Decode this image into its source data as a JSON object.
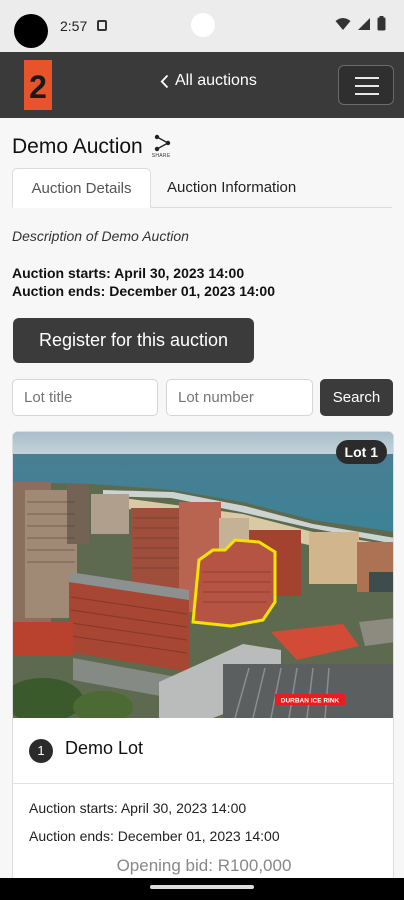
{
  "status_bar": {
    "time": "2:57"
  },
  "app_bar": {
    "logo_text": "2",
    "back_label": "All auctions"
  },
  "page": {
    "title": "Demo Auction",
    "share_label": "SHARE",
    "tabs": [
      {
        "label": "Auction Details",
        "active": true
      },
      {
        "label": "Auction Information",
        "active": false
      }
    ],
    "description": "Description of Demo Auction",
    "starts": "Auction starts: April 30, 2023 14:00",
    "ends": "Auction ends: December 01, 2023 14:00",
    "register_label": "Register for this auction"
  },
  "search": {
    "lot_title_placeholder": "Lot title",
    "lot_number_placeholder": "Lot number",
    "button_label": "Search"
  },
  "lot": {
    "badge": "Lot 1",
    "number": "1",
    "title": "Demo Lot",
    "starts": "Auction starts: April 30, 2023 14:00",
    "ends": "Auction ends: December 01, 2023 14:00",
    "opening_bid": "Opening bid: R100,000",
    "photo_sign": "DURBAN ICE RINK"
  },
  "colors": {
    "app_bar": "#3a3a3a",
    "logo": "#e8542a",
    "button": "#3b3b3b",
    "highlight": "#f2e400"
  }
}
